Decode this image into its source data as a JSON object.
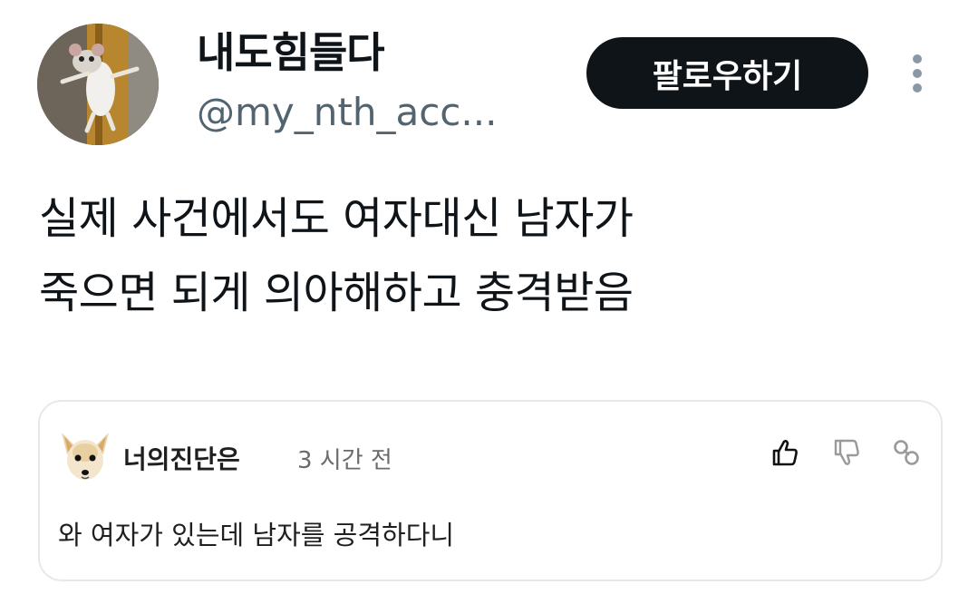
{
  "profile": {
    "display_name": "내도힘들다",
    "handle": "@my_nth_acc...",
    "avatar_icon": "mouse-avatar"
  },
  "actions": {
    "follow_label": "팔로우하기",
    "more_icon": "more-vertical-icon"
  },
  "tweet": {
    "lines": [
      "실제 사건에서도 여자대신 남자가",
      "죽으면 되게 의아해하고 충격받음"
    ]
  },
  "quoted_comment": {
    "author": "너의진단은",
    "time": "3 시간 전",
    "text": "와 여자가 있는데 남자를 공격하다니",
    "avatar_icon": "dog-avatar",
    "icons": [
      "thumbs-up-icon",
      "thumbs-down-icon",
      "share-link-icon"
    ]
  },
  "colors": {
    "follow_button_bg": "#0f1419",
    "handle_text": "#536471",
    "card_border": "#e6e9ec"
  }
}
